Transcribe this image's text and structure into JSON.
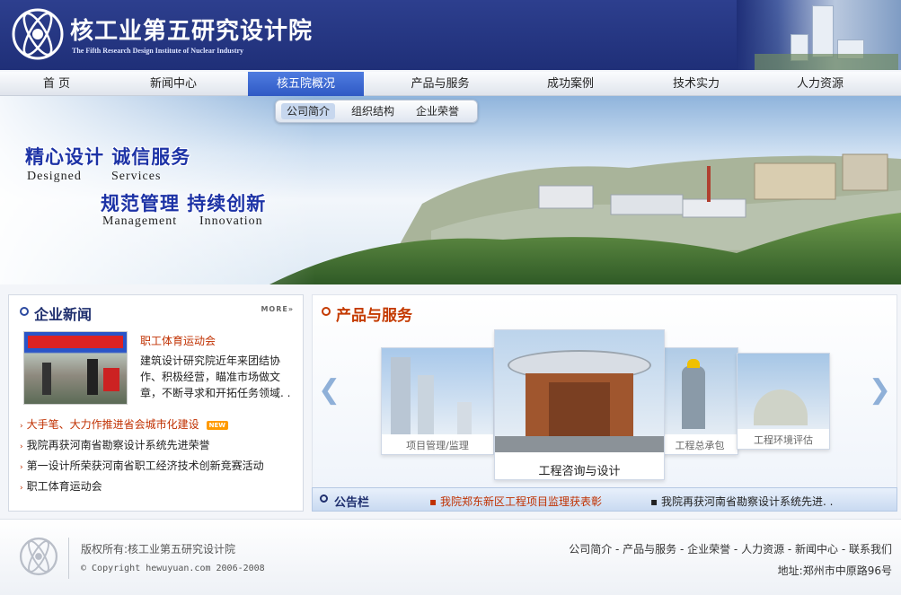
{
  "header": {
    "title": "核工业第五研究设计院",
    "subtitle": "The Fifth Research Design Institute of Nuclear Industry"
  },
  "nav": {
    "items": [
      "首 页",
      "新闻中心",
      "核五院概况",
      "产品与服务",
      "成功案例",
      "技术实力",
      "人力资源"
    ],
    "active_index": 2
  },
  "subnav": {
    "items": [
      "公司简介",
      "组织结构",
      "企业荣誉"
    ]
  },
  "banner": {
    "slogan1": "精心设计  诚信服务",
    "slogan1_en_a": "Designed",
    "slogan1_en_b": "Services",
    "slogan2": "规范管理  持续创新",
    "slogan2_en_a": "Management",
    "slogan2_en_b": "Innovation"
  },
  "news": {
    "title": "企业新闻",
    "more": "MORE»",
    "featured_title": "职工体育运动会",
    "featured_desc": "建筑设计研究院近年来团结协作、积极经营，瞄准市场做文章，不断寻求和开拓任务领域. .",
    "items": [
      "大手笔、大力作推进省会城市化建设",
      "我院再获河南省勘察设计系统先进荣誉",
      "第一设计所荣获河南省职工经济技术创新竞赛活动",
      "职工体育运动会"
    ],
    "new_badge": "NEW"
  },
  "products": {
    "title": "产品与服务",
    "cards": [
      "项目管理/监理",
      "工程咨询与设计",
      "工程总承包",
      "工程环境评估"
    ],
    "prev": "❮",
    "next": "❯"
  },
  "notice": {
    "label": "公告栏",
    "items": [
      "我院郑东新区工程项目监理获表彰",
      "我院再获河南省勘察设计系统先进. ."
    ]
  },
  "footer": {
    "copyright": "版权所有:核工业第五研究设计院",
    "copyright_en": "© Copyright hewuyuan.com 2006-2008",
    "links": "公司简介 - 产品与服务 - 企业荣誉 - 人力资源 - 新闻中心 - 联系我们",
    "address": "地址:郑州市中原路96号"
  },
  "colors": {
    "header_bg": "#1f2f78",
    "nav_active": "#2f59c4",
    "accent_red": "#c03000",
    "slogan_blue": "#1d33a6"
  }
}
